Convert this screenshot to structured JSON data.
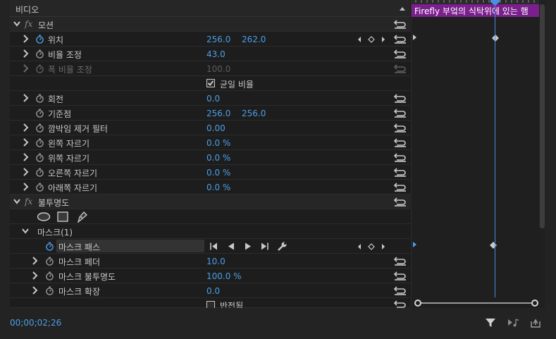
{
  "header": {
    "title": "비디오"
  },
  "timeline": {
    "clip_label": "Firefly 부엌의 식탁위에 있는 햄"
  },
  "motion": {
    "section_label": "모션",
    "position": {
      "label": "위치",
      "x": "256.0",
      "y": "262.0"
    },
    "scale": {
      "label": "비율 조정",
      "value": "43.0"
    },
    "scale_width": {
      "label": "폭 비율 조정",
      "value": "100.0"
    },
    "uniform_scale": {
      "label": "균일 비율"
    },
    "rotation": {
      "label": "회전",
      "value": "0.0"
    },
    "anchor": {
      "label": "기준점",
      "x": "256.0",
      "y": "256.0"
    },
    "antiflicker": {
      "label": "깜박임 제거 필터",
      "value": "0.00"
    },
    "crop_left": {
      "label": "왼쪽 자르기",
      "value": "0.0 %"
    },
    "crop_top": {
      "label": "위쪽 자르기",
      "value": "0.0 %"
    },
    "crop_right": {
      "label": "오른쪽 자르기",
      "value": "0.0 %"
    },
    "crop_bottom": {
      "label": "아래쪽 자르기",
      "value": "0.0 %"
    }
  },
  "opacity": {
    "section_label": "불투명도",
    "mask": {
      "label": "마스크(1)",
      "path": {
        "label": "마스크 패스"
      },
      "feather": {
        "label": "마스크 페더",
        "value": "10.0"
      },
      "opacity": {
        "label": "마스크 불투명도",
        "value": "100.0 %"
      },
      "expansion": {
        "label": "마스크 확장",
        "value": "0.0"
      },
      "inverted": {
        "label": "반전됨"
      }
    }
  },
  "footer": {
    "timecode": "00;00;02;26"
  },
  "colors": {
    "accent": "#4b9fe8",
    "clip": "#7a1f8c",
    "playhead": "#4a8fe0"
  }
}
